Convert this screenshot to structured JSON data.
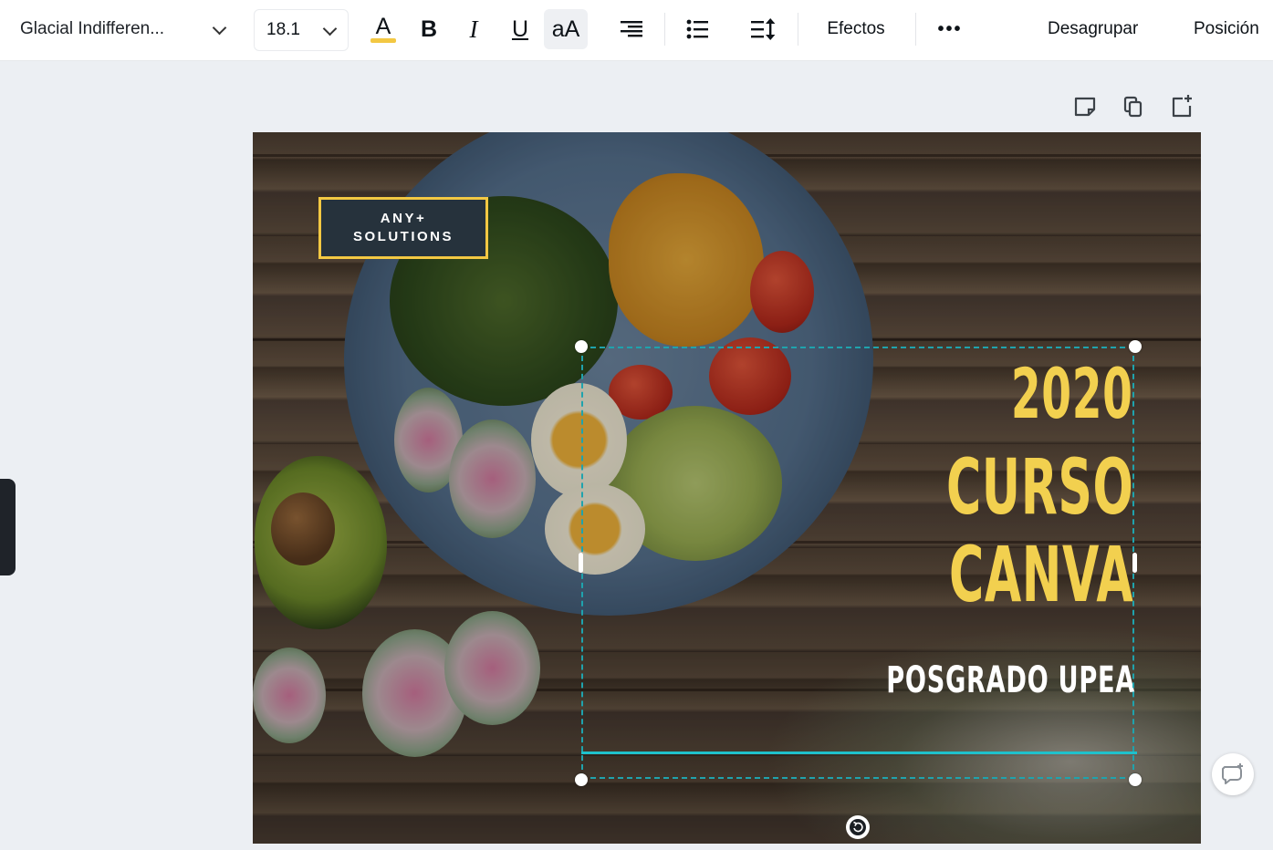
{
  "toolbar": {
    "font_family": "Glacial Indifferen...",
    "font_size": "18.1",
    "text_color": "#f3c843",
    "case_label": "aA",
    "effects_label": "Efectos",
    "more_label": "•••",
    "ungroup_label": "Desagrupar",
    "position_label": "Posición"
  },
  "page_tools": {
    "icons": [
      "note-icon",
      "duplicate-page-icon",
      "add-page-icon"
    ]
  },
  "design": {
    "logo_line1": "ANY+",
    "logo_line2": "SOLUTIONS",
    "title_line1": "2020",
    "title_line2": "CURSO",
    "title_line3": "CANVA",
    "subtitle": "POSGRADO UPEA",
    "title_color": "#f2d04f",
    "accent_color": "#f3c843",
    "selection_color": "#1fa3ad"
  }
}
